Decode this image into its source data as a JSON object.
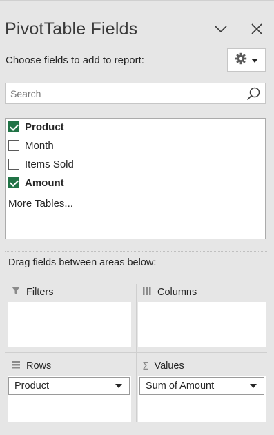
{
  "panel": {
    "title": "PivotTable Fields",
    "choose_label": "Choose fields to add to report:",
    "icons": {
      "collapse": "chevron-down-icon",
      "close": "close-icon",
      "settings": "gear-icon"
    }
  },
  "search": {
    "placeholder": "Search",
    "value": ""
  },
  "fields": [
    {
      "label": "Product",
      "checked": true
    },
    {
      "label": "Month",
      "checked": false
    },
    {
      "label": "Items Sold",
      "checked": false
    },
    {
      "label": "Amount",
      "checked": true
    }
  ],
  "more_tables": "More Tables...",
  "drag_label": "Drag fields between areas below:",
  "areas": {
    "filters": {
      "label": "Filters",
      "icon": "filter-icon"
    },
    "columns": {
      "label": "Columns",
      "icon": "columns-icon"
    },
    "rows": {
      "label": "Rows",
      "icon": "rows-icon",
      "item": "Product"
    },
    "values": {
      "label": "Values",
      "icon": "sigma-icon",
      "item": "Sum of Amount"
    }
  },
  "colors": {
    "accent": "#217346",
    "background": "#e6e6e6"
  }
}
